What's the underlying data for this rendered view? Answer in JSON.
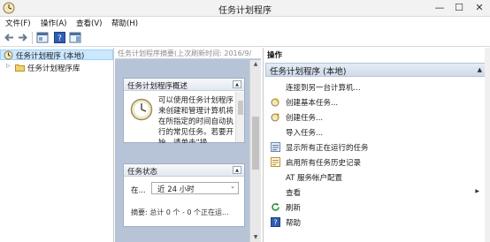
{
  "window": {
    "title": "任务计划程序",
    "minimize_glyph": "—",
    "maximize_glyph": "☐",
    "close_glyph": "✕"
  },
  "menu": {
    "items": [
      {
        "label": "文件(F)"
      },
      {
        "label": "操作(A)"
      },
      {
        "label": "查看(V)"
      },
      {
        "label": "帮助(H)"
      }
    ]
  },
  "toolbar": {
    "buttons": [
      "back-arrow-icon",
      "forward-arrow-icon",
      "console-tree-icon",
      "help-icon",
      "action-pane-icon"
    ]
  },
  "tree": {
    "items": [
      {
        "label": "任务计划程序 (本地)",
        "selected": true
      },
      {
        "label": "任务计划程序库",
        "selected": false
      }
    ]
  },
  "middle": {
    "header": "任务计划程序摘要(上次刷新时间: 2016/9/",
    "overview": {
      "title": "任务计划程序概述",
      "text": "可以使用任务计划程序来创建和管理计算机将在所指定的时间自动执行的常见任务。若要开始，请单击“操"
    },
    "status": {
      "title": "任务状态",
      "label": "在...",
      "selected": "近 24 小时",
      "summary": "摘要: 总计 0 个 - 0 个正在运..."
    }
  },
  "actions": {
    "header": "操作",
    "group": "任务计划程序 (本地)",
    "items": [
      {
        "label": "连接到另一台计算机...",
        "icon": "blank"
      },
      {
        "label": "创建基本任务...",
        "icon": "create-basic-task-icon"
      },
      {
        "label": "创建任务...",
        "icon": "create-task-icon"
      },
      {
        "label": "导入任务...",
        "icon": "blank"
      },
      {
        "label": "显示所有正在运行的任务",
        "icon": "running-tasks-icon"
      },
      {
        "label": "启用所有任务历史记录",
        "icon": "history-icon"
      },
      {
        "label": "AT 服务帐户配置",
        "icon": "blank"
      },
      {
        "label": "查看",
        "icon": "blank",
        "submenu": true
      },
      {
        "label": "刷新",
        "icon": "refresh-icon"
      },
      {
        "label": "帮助",
        "icon": "help-icon"
      }
    ]
  },
  "colors": {
    "selection": "#cce8ff",
    "middle_bg": "#b7c4d8",
    "group_header": "#d6e1ef"
  }
}
